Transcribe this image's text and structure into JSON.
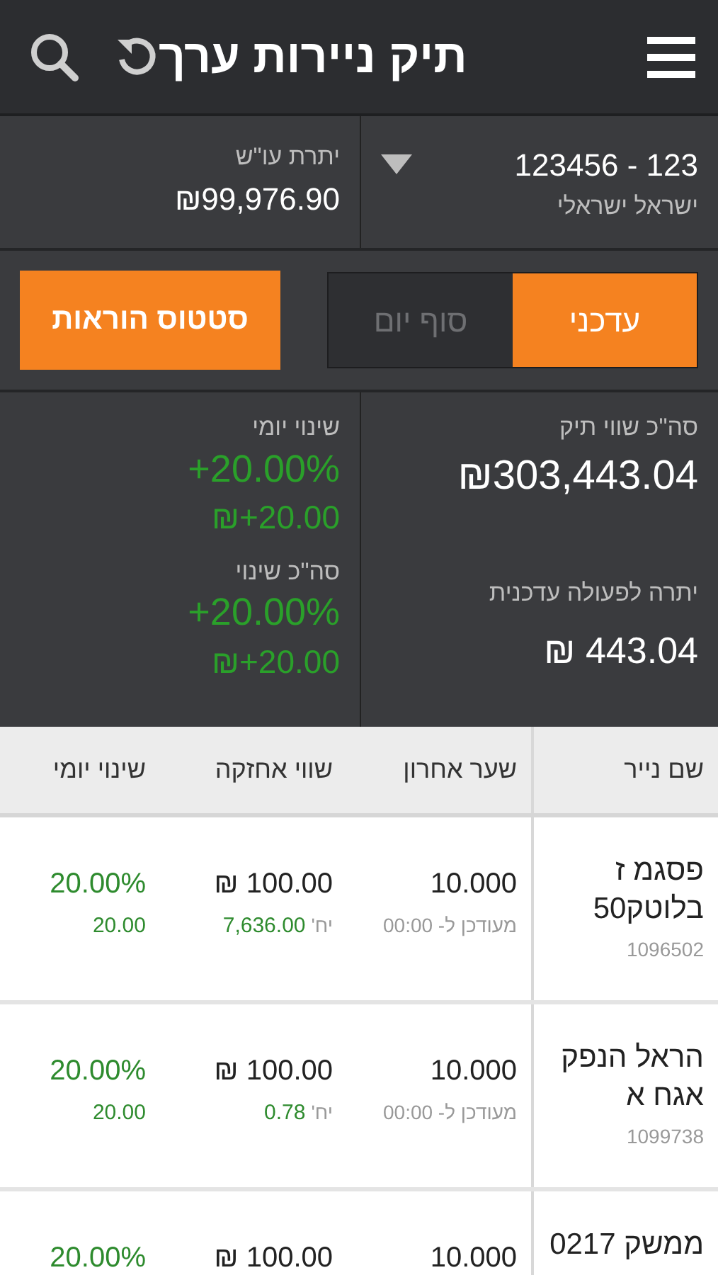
{
  "header": {
    "title": "תיק ניירות ערך"
  },
  "account": {
    "number": "123 - 123456",
    "owner": "ישראל ישראלי",
    "balance_label": "יתרת עו\"ש",
    "balance": "₪99,976.90"
  },
  "view_tabs": [
    {
      "label": "עדכני",
      "selected": true
    },
    {
      "label": "סוף יום",
      "selected": false
    }
  ],
  "orders_button": "סטטוס הוראות",
  "summary": {
    "portfolio_label": "סה\"כ שווי תיק",
    "portfolio_value": "₪303,443.04",
    "available_label": "יתרה לפעולה עדכנית",
    "available_value": "₪ 443.04",
    "daily_label": "שינוי יומי",
    "daily_pct": "+20.00%",
    "daily_amount": "₪+20.00",
    "total_label": "סה\"כ שינוי",
    "total_pct": "+20.00%",
    "total_amount": "₪+20.00"
  },
  "table": {
    "columns": [
      "שם נייר",
      "שער אחרון",
      "שווי אחזקה",
      "שינוי יומי"
    ],
    "rows": [
      {
        "name": "פסגמ ז בלוטק50",
        "id": "1096502",
        "last": "10.000",
        "updated": "מעודכן ל- 00:00",
        "holding": "₪ 100.00",
        "units": "7,636.00",
        "units_label": "יח'",
        "change_pct": "20.00%",
        "change": "20.00"
      },
      {
        "name": "הראל הנפק אגח א",
        "id": "1099738",
        "last": "10.000",
        "updated": "מעודכן ל- 00:00",
        "holding": "₪ 100.00",
        "units": "0.78",
        "units_label": "יח'",
        "change_pct": "20.00%",
        "change": "20.00"
      },
      {
        "name": "ממשק 0217",
        "last": "10.000",
        "holding": "₪ 100.00",
        "change_pct": "20.00%"
      }
    ]
  }
}
